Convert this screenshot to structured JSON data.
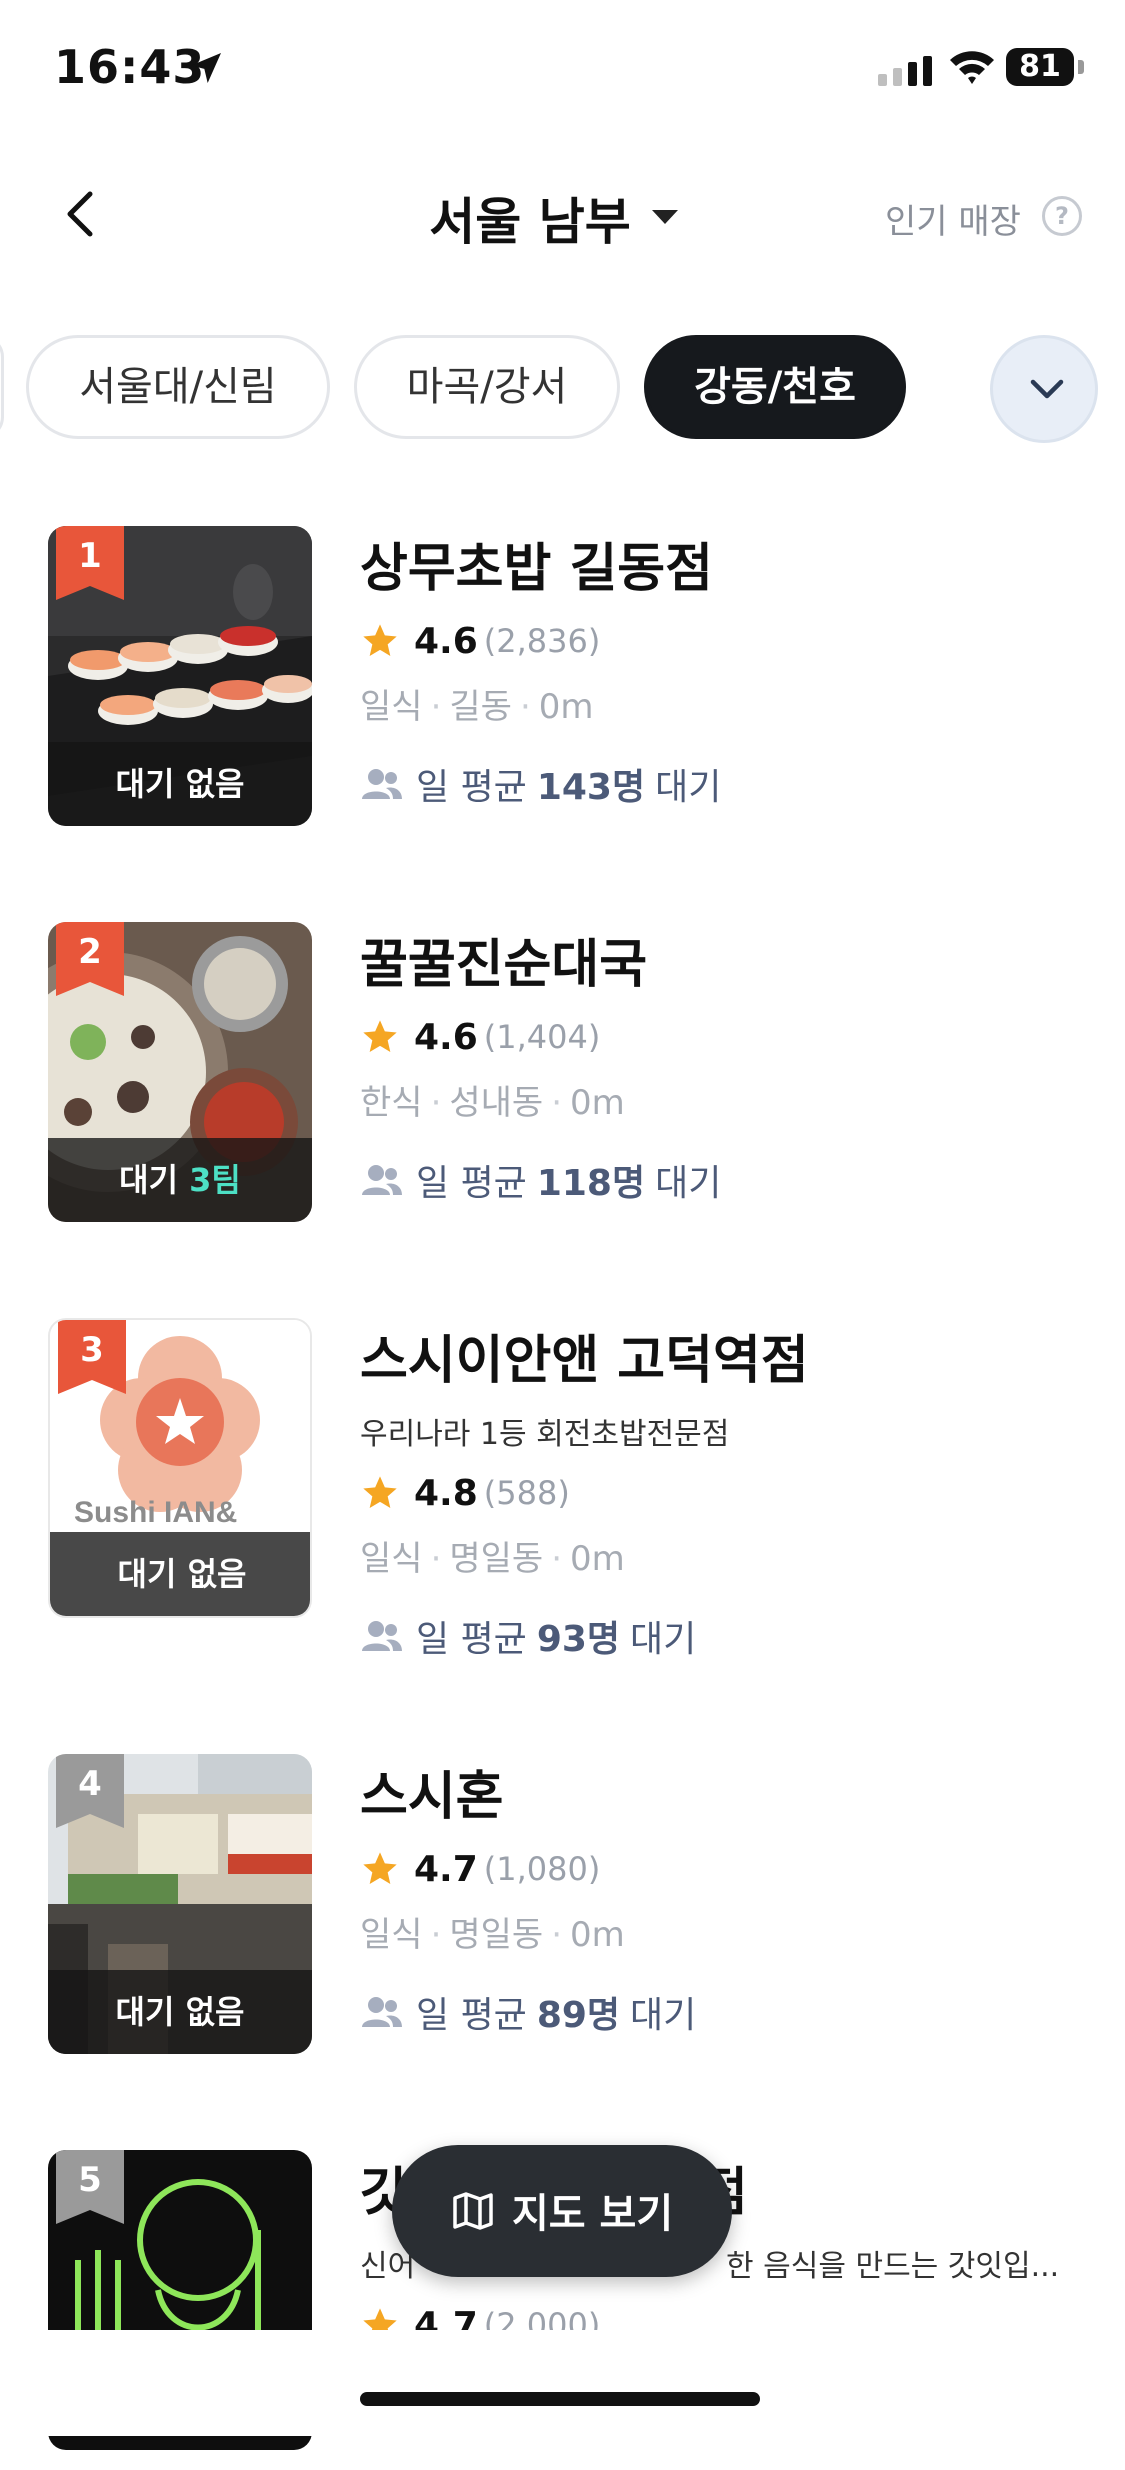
{
  "status_bar": {
    "time": "16:43",
    "battery": "81"
  },
  "header": {
    "title": "서울 남부",
    "popular_label": "인기 매장",
    "help_glyph": "?"
  },
  "chips": [
    "서울대/신림",
    "마곡/강서",
    "강동/천호"
  ],
  "active_chip": "강동/천호",
  "stores": [
    {
      "rank": "1",
      "name": "상무초밥 길동점",
      "tagline": "",
      "rating": "4.6",
      "reviews": "(2,836)",
      "cuisine": "일식",
      "area": "길동",
      "distance": "0m",
      "avg_prefix": "일 평균",
      "avg_count": "143명",
      "avg_suffix": "대기",
      "wait_prefix": "대기 없음",
      "wait_count": ""
    },
    {
      "rank": "2",
      "name": "꿀꿀진순대국",
      "tagline": "",
      "rating": "4.6",
      "reviews": "(1,404)",
      "cuisine": "한식",
      "area": "성내동",
      "distance": "0m",
      "avg_prefix": "일 평균",
      "avg_count": "118명",
      "avg_suffix": "대기",
      "wait_prefix": "대기",
      "wait_count": "3팀"
    },
    {
      "rank": "3",
      "name": "스시이안앤 고덕역점",
      "tagline": "우리나라 1등 회전초밥전문점",
      "rating": "4.8",
      "reviews": "(588)",
      "cuisine": "일식",
      "area": "명일동",
      "distance": "0m",
      "avg_prefix": "일 평균",
      "avg_count": "93명",
      "avg_suffix": "대기",
      "wait_prefix": "대기 없음",
      "wait_count": ""
    },
    {
      "rank": "4",
      "name": "스시혼",
      "tagline": "",
      "rating": "4.7",
      "reviews": "(1,080)",
      "cuisine": "일식",
      "area": "명일동",
      "distance": "0m",
      "avg_prefix": "일 평균",
      "avg_count": "89명",
      "avg_suffix": "대기",
      "wait_prefix": "대기 없음",
      "wait_count": ""
    },
    {
      "rank": "5",
      "name": "갓",
      "name_end": "점",
      "tagline_start": "신어",
      "tagline_end": "한 음식을 만드는 갓잇입...",
      "rating": "4.7",
      "reviews": "(2,000)"
    }
  ],
  "thumb3_logo_text": "Sushi IAN&",
  "map_button": {
    "label": "지도 보기"
  },
  "colors": {
    "active_chip": "#16191d",
    "rank_top": "#e8563a",
    "rank_other": "#9a9a9a",
    "star": "#f5a623",
    "wait_count": "#4de0c5",
    "avg_text": "#4c5a78"
  },
  "icons": [
    "location-arrow-icon",
    "signal-icon",
    "wifi-icon",
    "back-chevron-icon",
    "caret-down-icon",
    "help-icon",
    "chevron-down-icon",
    "star-icon",
    "people-icon",
    "map-icon"
  ]
}
